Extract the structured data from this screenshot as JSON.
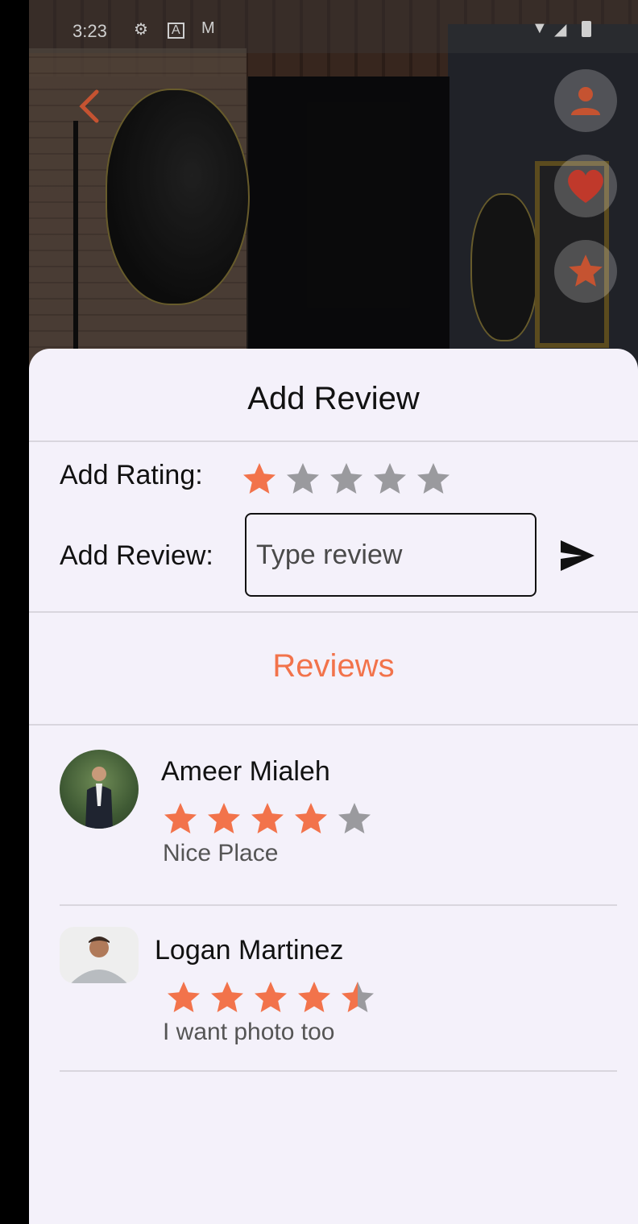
{
  "status_bar": {
    "time": "3:23",
    "icons": [
      "gear-icon",
      "a-badge-icon",
      "gmail-icon",
      "wifi-icon",
      "signal-icon",
      "battery-icon"
    ]
  },
  "header": {
    "back_icon": "chevron-left-icon",
    "actions": [
      "person-icon",
      "heart-icon",
      "star-icon"
    ]
  },
  "sheet": {
    "title": "Add Review",
    "rating_label": "Add Rating:",
    "rating_value": 1,
    "rating_max": 5,
    "review_label": "Add Review:",
    "review_placeholder": "Type review",
    "review_value": "",
    "send_icon": "send-icon"
  },
  "reviews": {
    "title": "Reviews",
    "items": [
      {
        "name": "Ameer Mialeh",
        "rating": 4,
        "text": "Nice Place"
      },
      {
        "name": "Logan Martinez",
        "rating": 4.5,
        "text": "I want photo too"
      }
    ]
  },
  "colors": {
    "accent": "#f2734b",
    "star_filled": "#f2734b",
    "star_empty": "#9a9a9e",
    "sheet_bg": "#f4f1fa",
    "icon_red": "#c55331"
  }
}
